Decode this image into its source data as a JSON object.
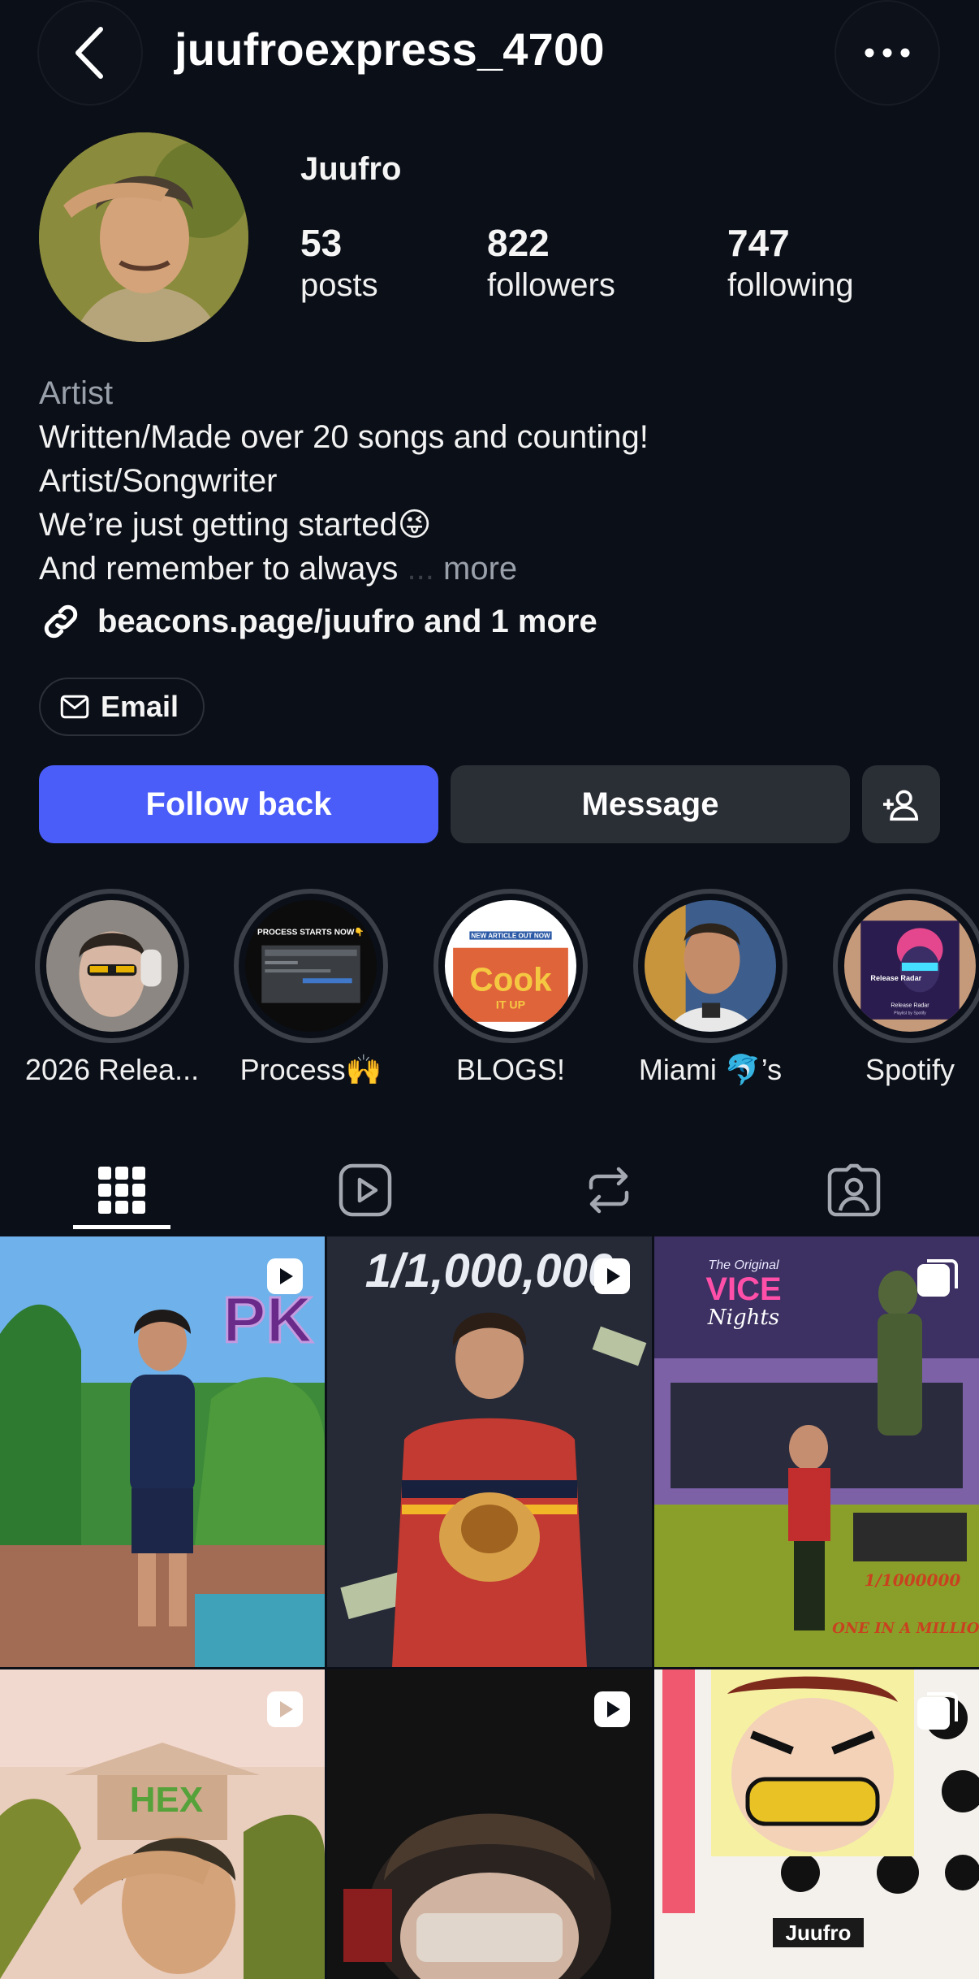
{
  "header": {
    "username": "juufroexpress_4700",
    "back_icon": "chevron-left-icon",
    "more_icon": "ellipsis-icon"
  },
  "profile": {
    "display_name": "Juufro",
    "stats": [
      {
        "value": "53",
        "label": "posts"
      },
      {
        "value": "822",
        "label": "followers"
      },
      {
        "value": "747",
        "label": "following"
      }
    ],
    "category": "Artist",
    "bio_lines": [
      "Written/Made over 20 songs and counting!",
      "Artist/Songwriter",
      "We’re just getting started😜",
      "And remember to always"
    ],
    "bio_ellipsis": "...",
    "bio_more": "more",
    "link_text": "beacons.page/juufro and 1 more",
    "email_label": "Email"
  },
  "actions": {
    "follow_label": "Follow back",
    "message_label": "Message"
  },
  "highlights": [
    {
      "label": "2026 Relea..."
    },
    {
      "label": "Process🙌"
    },
    {
      "label": "BLOGS!"
    },
    {
      "label": "Miami 🐬’s"
    },
    {
      "label": "Spotify"
    }
  ],
  "highlight_texts": {
    "process": "PROCESS STARTS NOW👇",
    "blog_top": "NEW ARTICLE OUT NOW",
    "blog_cook": "Cook",
    "blog_itup": "IT UP",
    "spotify_title": "Release Radar",
    "spotify_sub": "Release Radar",
    "spotify_foot": "Playlist by Spotify"
  },
  "tabs": [
    "grid-icon",
    "reels-icon",
    "reposts-icon",
    "tagged-icon"
  ],
  "grid_texts": {
    "post1": "PK",
    "post2": "1/1,000,000",
    "post3_line1": "The Original",
    "post3_line2": "VICE",
    "post3_line3": "Nights",
    "post3_a": "1/1000000",
    "post3_b": "ONE IN A MILLION",
    "post4": "HEX",
    "post6_watermark": "Juufro"
  },
  "colors": {
    "background": "#0b0f17",
    "accent": "#4a5df9",
    "secondary_button": "#2a2e35"
  }
}
